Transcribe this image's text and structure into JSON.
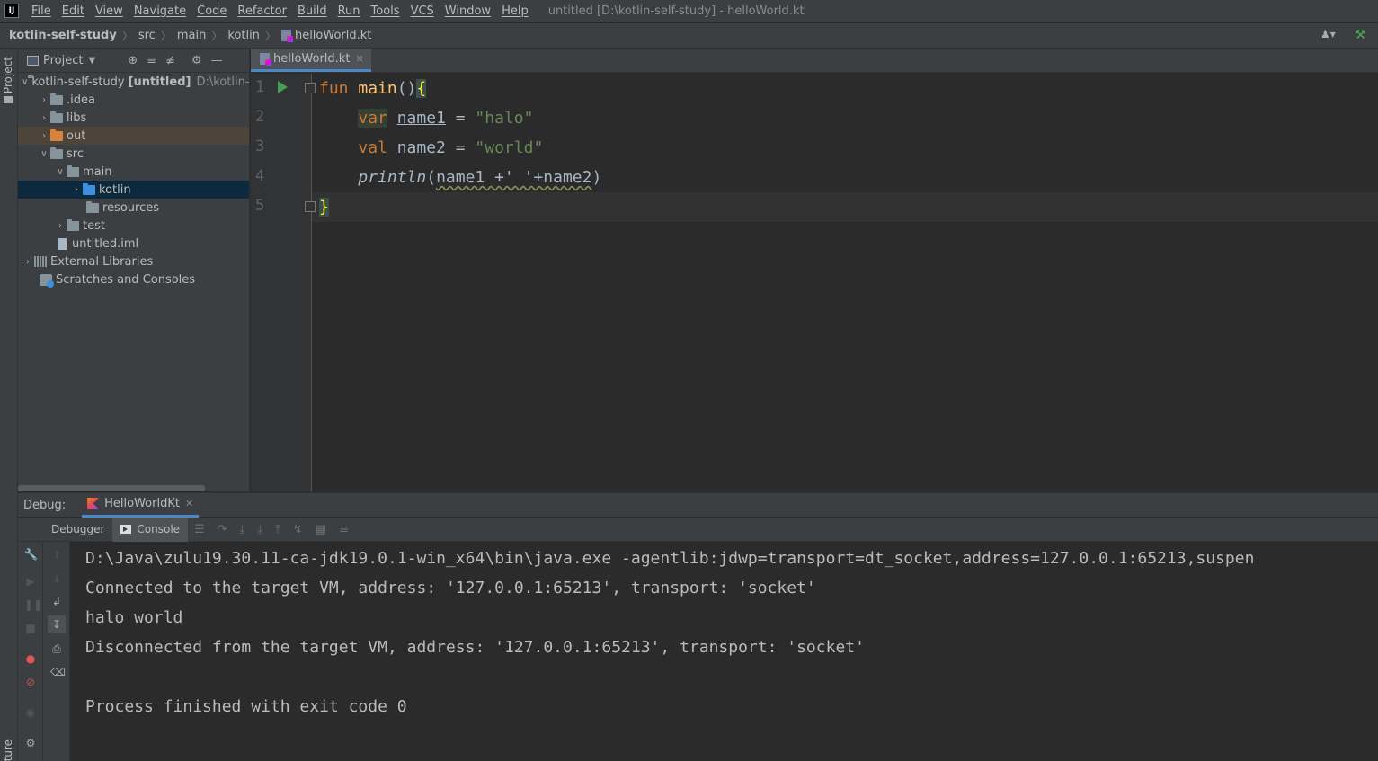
{
  "menubar": {
    "logo": "IJ",
    "items": [
      "File",
      "Edit",
      "View",
      "Navigate",
      "Code",
      "Refactor",
      "Build",
      "Run",
      "Tools",
      "VCS",
      "Window",
      "Help"
    ],
    "window_title": "untitled [D:\\kotlin-self-study] - helloWorld.kt"
  },
  "breadcrumb": [
    "kotlin-self-study",
    "src",
    "main",
    "kotlin",
    "helloWorld.kt"
  ],
  "left_strip": {
    "project_tab": "Project",
    "structure_tab": "ture"
  },
  "project": {
    "title": "Project",
    "tree": {
      "root_name": "kotlin-self-study",
      "root_tag": "[untitled]",
      "root_path": "D:\\kotlin-",
      "idea": ".idea",
      "libs": "libs",
      "out": "out",
      "src": "src",
      "main": "main",
      "kotlin": "kotlin",
      "resources": "resources",
      "test": "test",
      "iml": "untitled.iml",
      "external": "External Libraries",
      "scratches": "Scratches and Consoles"
    }
  },
  "editor": {
    "tab_label": "helloWorld.kt",
    "line_numbers": [
      "1",
      "2",
      "3",
      "4",
      "5"
    ],
    "code": {
      "l1_kw": "fun",
      "l1_fn": "main",
      "l1_paren": "()",
      "l1_brace": "{",
      "l2_kw": "var",
      "l2_name": "name1",
      "l2_eq": " = ",
      "l2_str": "\"halo\"",
      "l3_kw": "val",
      "l3_rest": " name2 = ",
      "l3_str": "\"world\"",
      "l4_fn": "println",
      "l4_open": "(",
      "l4_arg1": "name1",
      "l4_mid": " +' '+name2",
      "l4_close": ")",
      "l5_brace": "}"
    }
  },
  "debug": {
    "label": "Debug:",
    "session_tab": "HelloWorldKt",
    "tabs": {
      "debugger": "Debugger",
      "console": "Console"
    }
  },
  "console": {
    "lines": [
      "D:\\Java\\zulu19.30.11-ca-jdk19.0.1-win_x64\\bin\\java.exe -agentlib:jdwp=transport=dt_socket,address=127.0.0.1:65213,suspen",
      "Connected to the target VM, address: '127.0.0.1:65213', transport: 'socket'",
      "halo world",
      "Disconnected from the target VM, address: '127.0.0.1:65213', transport: 'socket'",
      "",
      "Process finished with exit code 0"
    ]
  },
  "colors": {
    "keyword": "#cc7832",
    "string": "#6a8759",
    "function": "#ffc66d",
    "accent": "#4a88c7",
    "run": "#499c54"
  }
}
